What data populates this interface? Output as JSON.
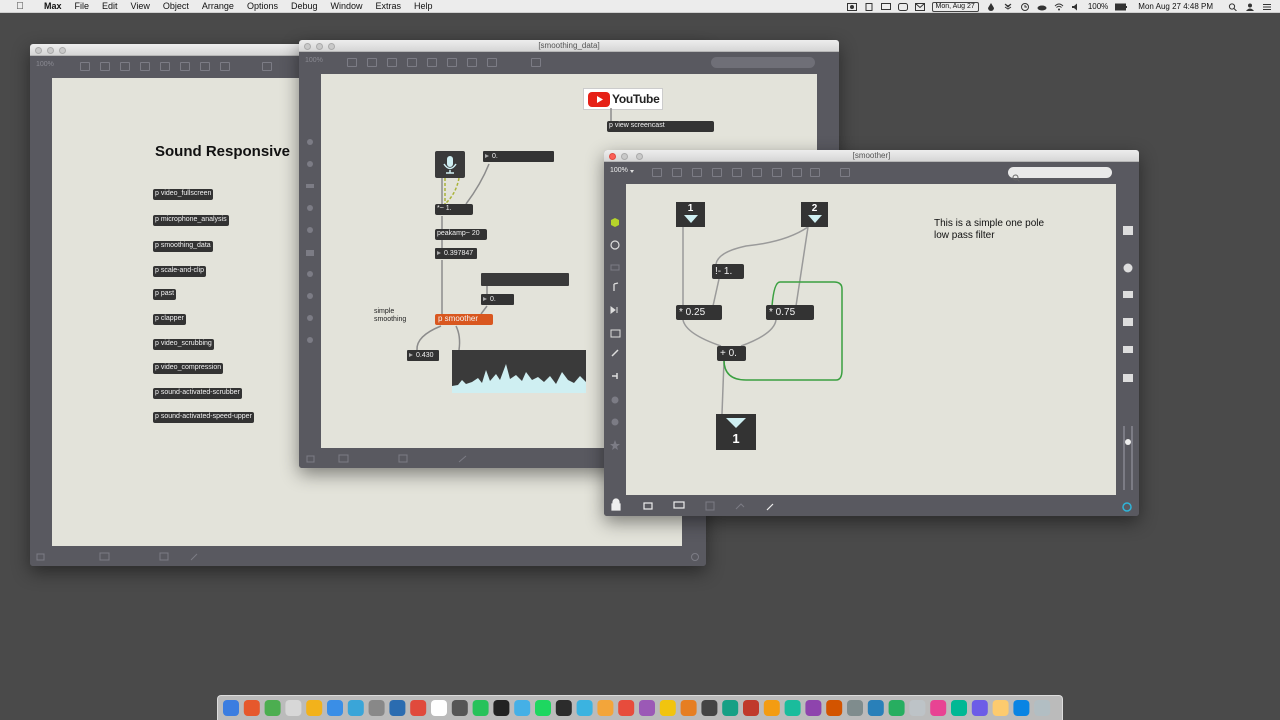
{
  "menubar": {
    "apple": "",
    "app": "Max",
    "items": [
      "File",
      "Edit",
      "View",
      "Object",
      "Arrange",
      "Options",
      "Debug",
      "Window",
      "Extras",
      "Help"
    ],
    "date_badge": "Mon, Aug 27",
    "battery": "100%",
    "clock": "Mon Aug 27  4:48 PM"
  },
  "main_window": {
    "zoom": "100%",
    "title": "Sound Responsive",
    "subpatchers": [
      "p video_fullscreen",
      "p microphone_analysis",
      "p smoothing_data",
      "p scale-and-clip",
      "p past",
      "p clapper",
      "p video_scrubbing",
      "p video_compression",
      "p sound-activated-scrubber",
      "p sound-activated-speed-upper"
    ]
  },
  "smoothing_window": {
    "title": "[smoothing_data]",
    "zoom": "100%",
    "youtube_label": "YouTube",
    "view_screencast": "p view screencast",
    "number_top": "0.",
    "multiply": "*~ 1.",
    "peakamp": "peakamp~ 20",
    "peak_value": "0.397847",
    "number_mid": "0.",
    "smoother_label": "p smoother",
    "simple_smoothing": "simple smoothing",
    "output_value": "0.430"
  },
  "smoother_window": {
    "title": "[smoother]",
    "zoom": "100%",
    "inlet1": "1",
    "inlet2": "2",
    "rsub": "!- 1.",
    "mul1": "* 0.25",
    "mul2": "* 0.75",
    "add": "+ 0.",
    "outlet1": "1",
    "comment": "This is a simple one pole low pass filter"
  },
  "colors": {
    "desktop": "#4a4a4a",
    "canvas": "#e3e3da",
    "window_chrome": "#595960",
    "object": "#333333",
    "smoother_accent": "#d9571f",
    "patch_green": "#3aa040",
    "inlet_arrow": "#cfeff2"
  },
  "dock": {
    "icon_count": 46
  }
}
